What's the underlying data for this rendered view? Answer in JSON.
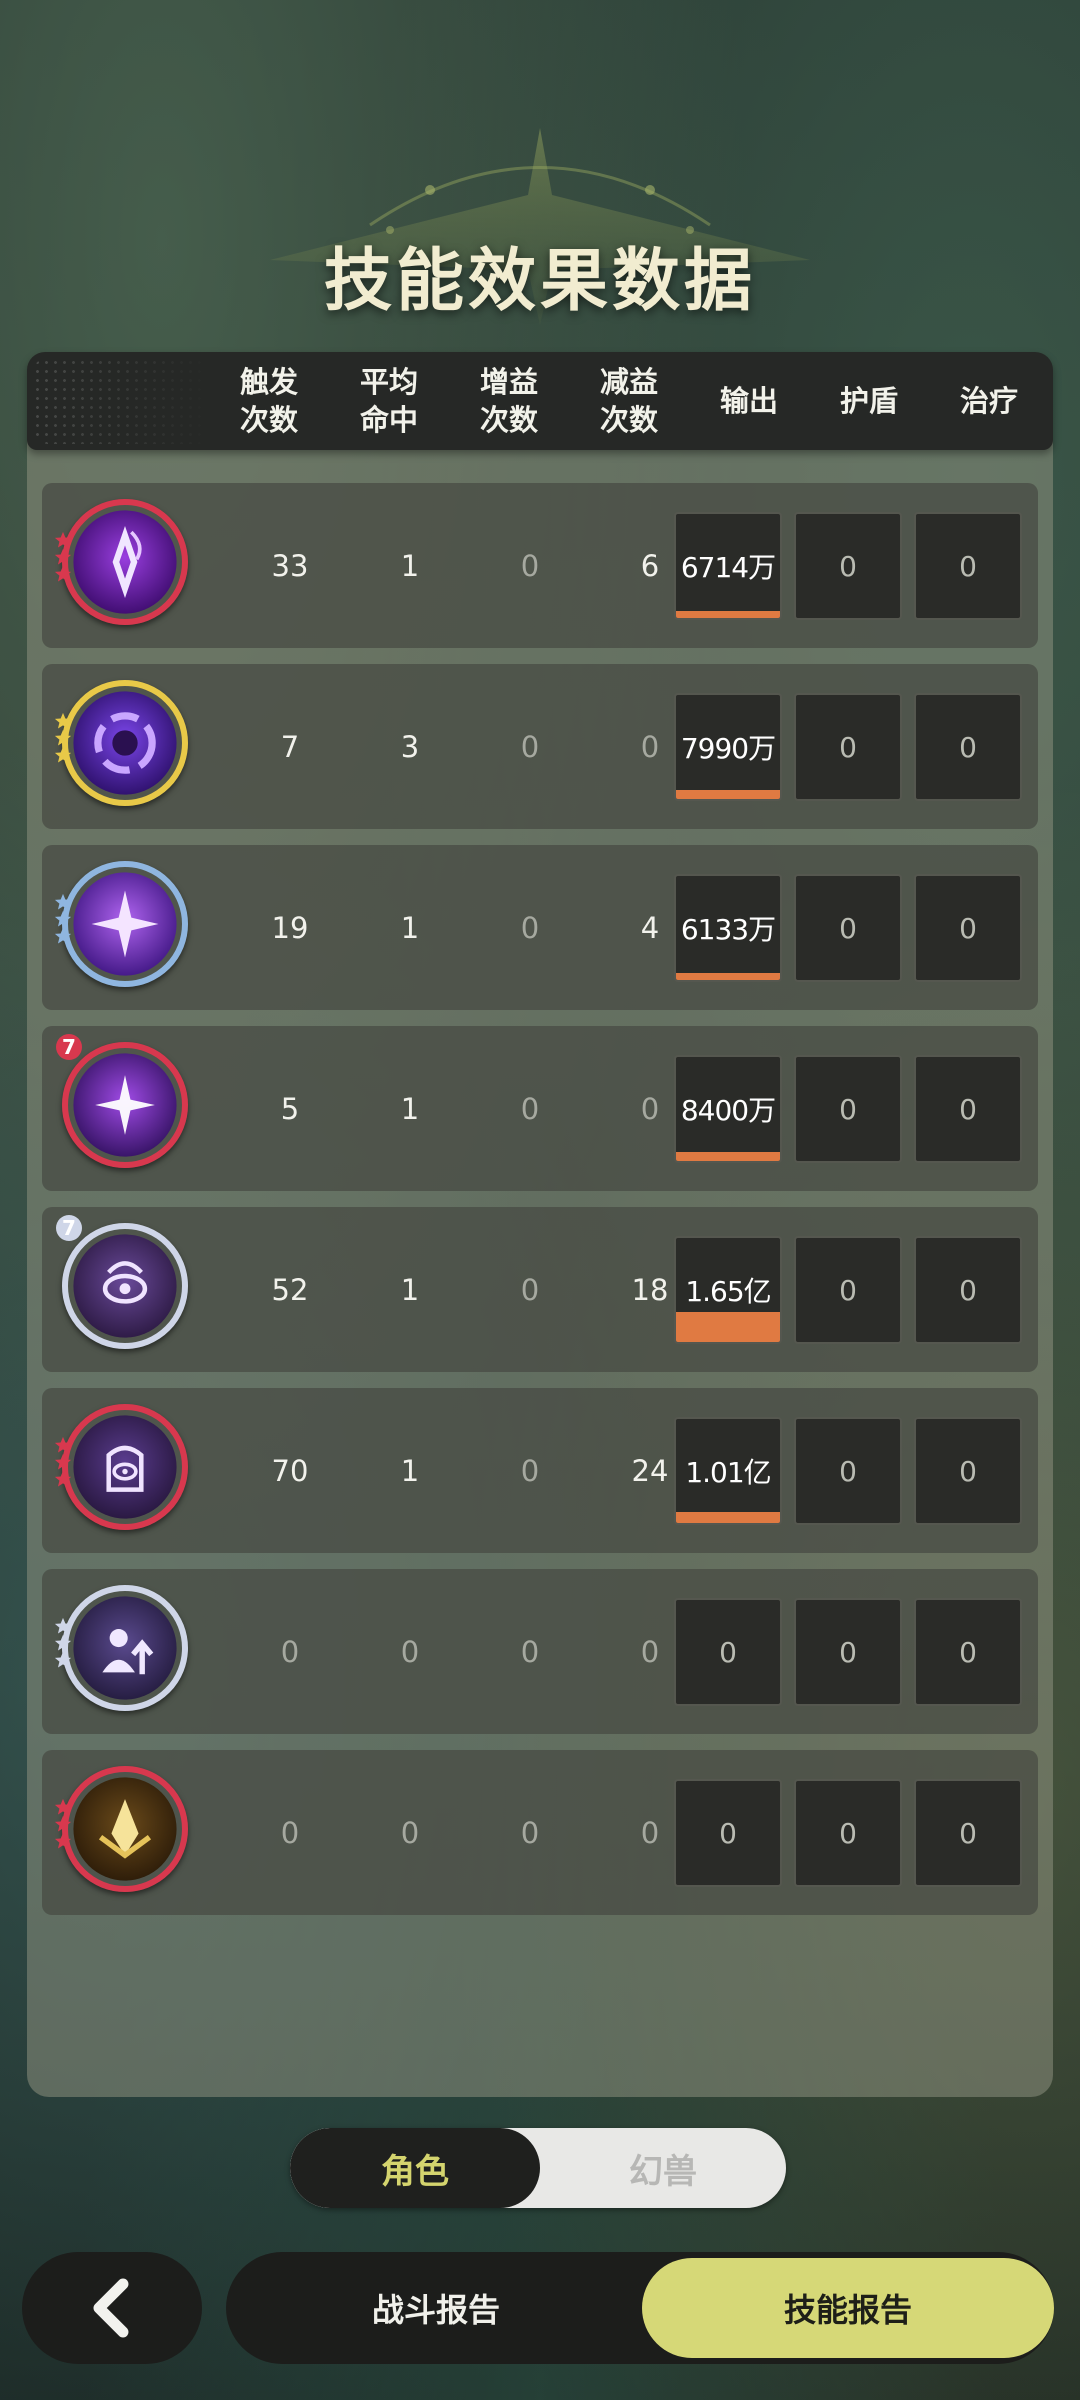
{
  "title": "技能效果数据",
  "headers": {
    "trigger": [
      "触发",
      "次数"
    ],
    "avg_hit": [
      "平均",
      "命中"
    ],
    "buff": [
      "增益",
      "次数"
    ],
    "debuff": [
      "减益",
      "次数"
    ],
    "output": "输出",
    "shield": "护盾",
    "heal": "治疗"
  },
  "rows": [
    {
      "icon": "purple-diamond-flame-skill-icon",
      "frame": "#d8384e",
      "triggers": "33",
      "avg_hit": "1",
      "buffs": "0",
      "debuffs": "6",
      "output": "6714万",
      "output_share": 0.3997,
      "shield": "0",
      "heal": "0"
    },
    {
      "icon": "purple-vortex-orb-skill-icon",
      "frame": "#e8c948",
      "triggers": "7",
      "avg_hit": "3",
      "buffs": "0",
      "debuffs": "0",
      "output": "7990万",
      "output_share": 0.4757,
      "shield": "0",
      "heal": "0"
    },
    {
      "icon": "purple-burst-skill-icon",
      "frame": "#8fb6e0",
      "triggers": "19",
      "avg_hit": "1",
      "buffs": "0",
      "debuffs": "4",
      "output": "6133万",
      "output_share": 0.3651,
      "shield": "0",
      "heal": "0"
    },
    {
      "icon": "purple-star-spark-skill-icon",
      "frame": "#d8384e",
      "badge": "7",
      "triggers": "5",
      "avg_hit": "1",
      "buffs": "0",
      "debuffs": "0",
      "output": "8400万",
      "output_share": 0.5001,
      "shield": "0",
      "heal": "0"
    },
    {
      "icon": "eye-sigil-skill-icon",
      "frame": "#cfd6e8",
      "badge": "7",
      "triggers": "52",
      "avg_hit": "1",
      "buffs": "0",
      "debuffs": "18",
      "output": "1.65亿",
      "output_share": 0.9823,
      "shield": "0",
      "heal": "0"
    },
    {
      "icon": "hamsa-eye-skill-icon",
      "frame": "#d8384e",
      "triggers": "70",
      "avg_hit": "1",
      "buffs": "0",
      "debuffs": "24",
      "output": "1.01亿",
      "output_share": 0.6013,
      "shield": "0",
      "heal": "0"
    },
    {
      "icon": "figure-arrow-up-skill-icon",
      "frame": "#cfd6e8",
      "triggers": "0",
      "avg_hit": "0",
      "buffs": "0",
      "debuffs": "0",
      "output": "0",
      "output_share": 0,
      "shield": "0",
      "heal": "0"
    },
    {
      "icon": "golden-crest-skill-icon",
      "frame": "#d8384e",
      "triggers": "0",
      "avg_hit": "0",
      "buffs": "0",
      "debuffs": "0",
      "output": "0",
      "output_share": 0,
      "shield": "0",
      "heal": "0"
    }
  ],
  "toggle": {
    "active": "角色",
    "inactive": "幻兽"
  },
  "nav": {
    "back_icon": "chevron-left-icon",
    "battle_report": "战斗报告",
    "skill_report": "技能报告"
  },
  "colors": {
    "accent": "#d6d877",
    "output_bar": "#e07a42",
    "title": "#f1ecd0"
  }
}
